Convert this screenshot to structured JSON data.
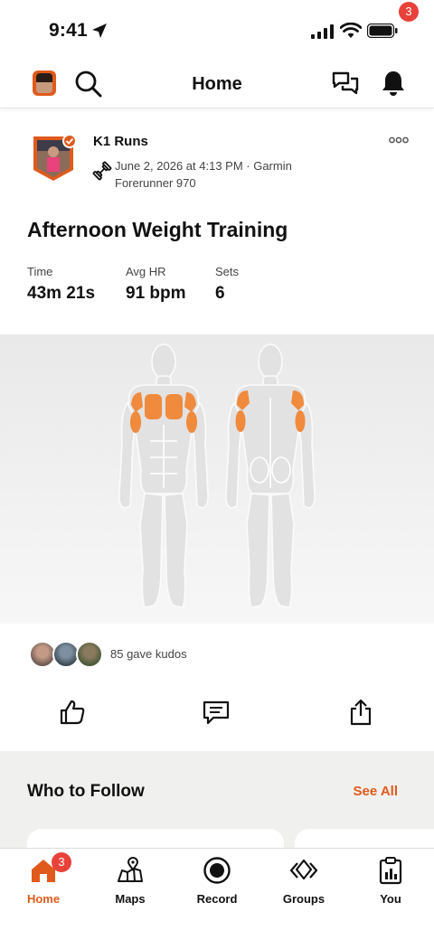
{
  "status_bar": {
    "time": "9:41"
  },
  "header": {
    "title": "Home",
    "notification_count": "3"
  },
  "activity": {
    "author": "K1 Runs",
    "meta": "June 2, 2026 at 4:13 PM · Garmin Forerunner 970",
    "title": "Afternoon Weight Training",
    "stats": [
      {
        "label": "Time",
        "value": "43m 21s"
      },
      {
        "label": "Avg HR",
        "value": "91 bpm"
      },
      {
        "label": "Sets",
        "value": "6"
      }
    ],
    "kudos_text": "85 gave kudos"
  },
  "who_to_follow": {
    "title": "Who to Follow",
    "see_all": "See All"
  },
  "tabs": [
    {
      "label": "Home",
      "icon": "home-icon",
      "badge": "3",
      "active": true
    },
    {
      "label": "Maps",
      "icon": "maps-icon"
    },
    {
      "label": "Record",
      "icon": "record-icon"
    },
    {
      "label": "Groups",
      "icon": "groups-icon"
    },
    {
      "label": "You",
      "icon": "you-icon"
    }
  ],
  "colors": {
    "accent": "#E05A1C",
    "badge": "#E8413A",
    "muscle_highlight": "#F08A3C"
  }
}
